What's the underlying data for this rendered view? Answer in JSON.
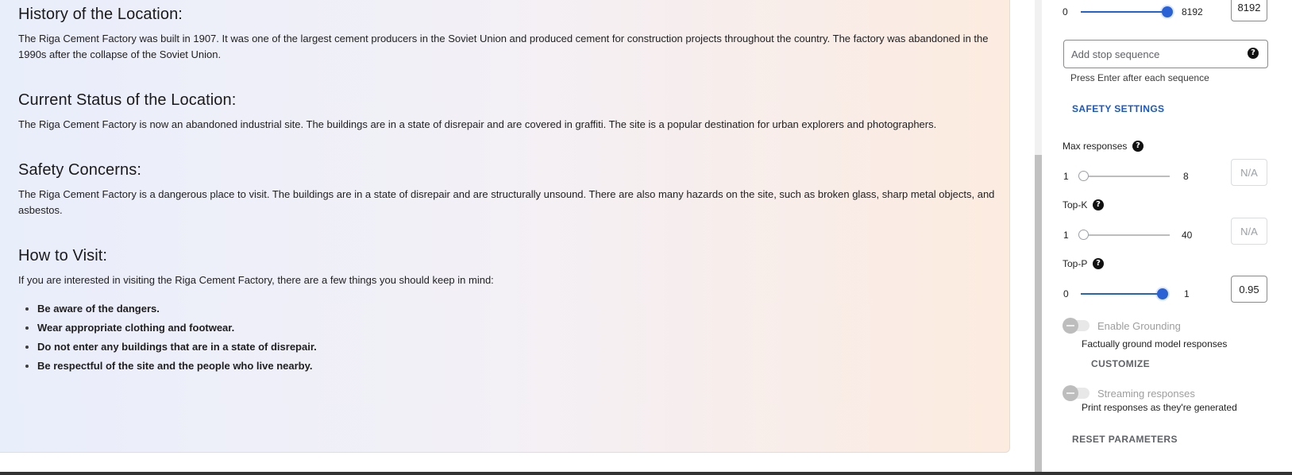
{
  "article": {
    "sections": [
      {
        "title": "History of the Location:",
        "body": "The Riga Cement Factory was built in 1907. It was one of the largest cement producers in the Soviet Union and produced cement for construction projects throughout the country. The factory was abandoned in the 1990s after the collapse of the Soviet Union."
      },
      {
        "title": "Current Status of the Location:",
        "body": "The Riga Cement Factory is now an abandoned industrial site. The buildings are in a state of disrepair and are covered in graffiti. The site is a popular destination for urban explorers and photographers."
      },
      {
        "title": "Safety Concerns:",
        "body": "The Riga Cement Factory is a dangerous place to visit. The buildings are in a state of disrepair and are structurally unsound. There are also many hazards on the site, such as broken glass, sharp metal objects, and asbestos."
      },
      {
        "title": "How to Visit:",
        "body": "If you are interested in visiting the Riga Cement Factory, there are a few things you should keep in mind:",
        "bullets": [
          "Be aware of the dangers.",
          "Wear appropriate clothing and footwear.",
          "Do not enter any buildings that are in a state of disrepair.",
          "Be respectful of the site and the people who live nearby."
        ]
      }
    ]
  },
  "panel": {
    "output_length": {
      "min": "0",
      "max": "8192",
      "value": "8192",
      "fill": 1.0
    },
    "stop_sequence": {
      "placeholder": "Add stop sequence",
      "hint": "Press Enter after each sequence"
    },
    "safety_settings_label": "SAFETY SETTINGS",
    "max_responses": {
      "label": "Max responses",
      "min": "1",
      "max": "8",
      "value": "N/A",
      "fill": 0.0
    },
    "top_k": {
      "label": "Top-K",
      "min": "1",
      "max": "40",
      "value": "N/A",
      "fill": 0.0
    },
    "top_p": {
      "label": "Top-P",
      "min": "0",
      "max": "1",
      "value": "0.95",
      "fill": 0.95
    },
    "grounding": {
      "label": "Enable Grounding",
      "description": "Factually ground model responses",
      "customize_label": "CUSTOMIZE",
      "enabled": false
    },
    "streaming": {
      "label": "Streaming responses",
      "description": "Print responses as they're generated",
      "enabled": false
    },
    "reset_label": "RESET PARAMETERS",
    "help_glyph": "?"
  },
  "colors": {
    "accent": "#1f63d6",
    "muted": "#9aa0a6",
    "link": "#1a57c8"
  }
}
